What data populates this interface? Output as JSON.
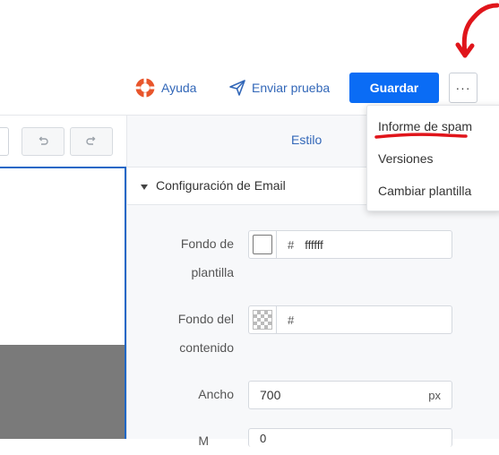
{
  "header": {
    "help_label": "Ayuda",
    "send_test_label": "Enviar prueba",
    "save_label": "Guardar",
    "more_label": "···"
  },
  "panel": {
    "tab_label": "Estilo",
    "section_title": "Configuración de Email",
    "fields": {
      "template_bg_label_1": "Fondo de",
      "template_bg_label_2": "plantilla",
      "template_bg_hash": "#",
      "template_bg_value": "ffffff",
      "content_bg_label_1": "Fondo del",
      "content_bg_label_2": "contenido",
      "content_bg_hash": "#",
      "width_label": "Ancho",
      "width_value": "700",
      "width_unit": "px",
      "next_label": "M",
      "next_value": "0"
    }
  },
  "menu": {
    "items": [
      "Informe de spam",
      "Versiones",
      "Cambiar plantilla"
    ]
  },
  "colors": {
    "primary": "#0a6cf5",
    "link": "#3267b8",
    "annotation": "#e0151b"
  },
  "icons": {
    "help": "lifebuoy-icon",
    "send": "paper-plane-icon",
    "undo": "undo-icon",
    "redo": "redo-icon",
    "caret": "caret-down-icon"
  }
}
